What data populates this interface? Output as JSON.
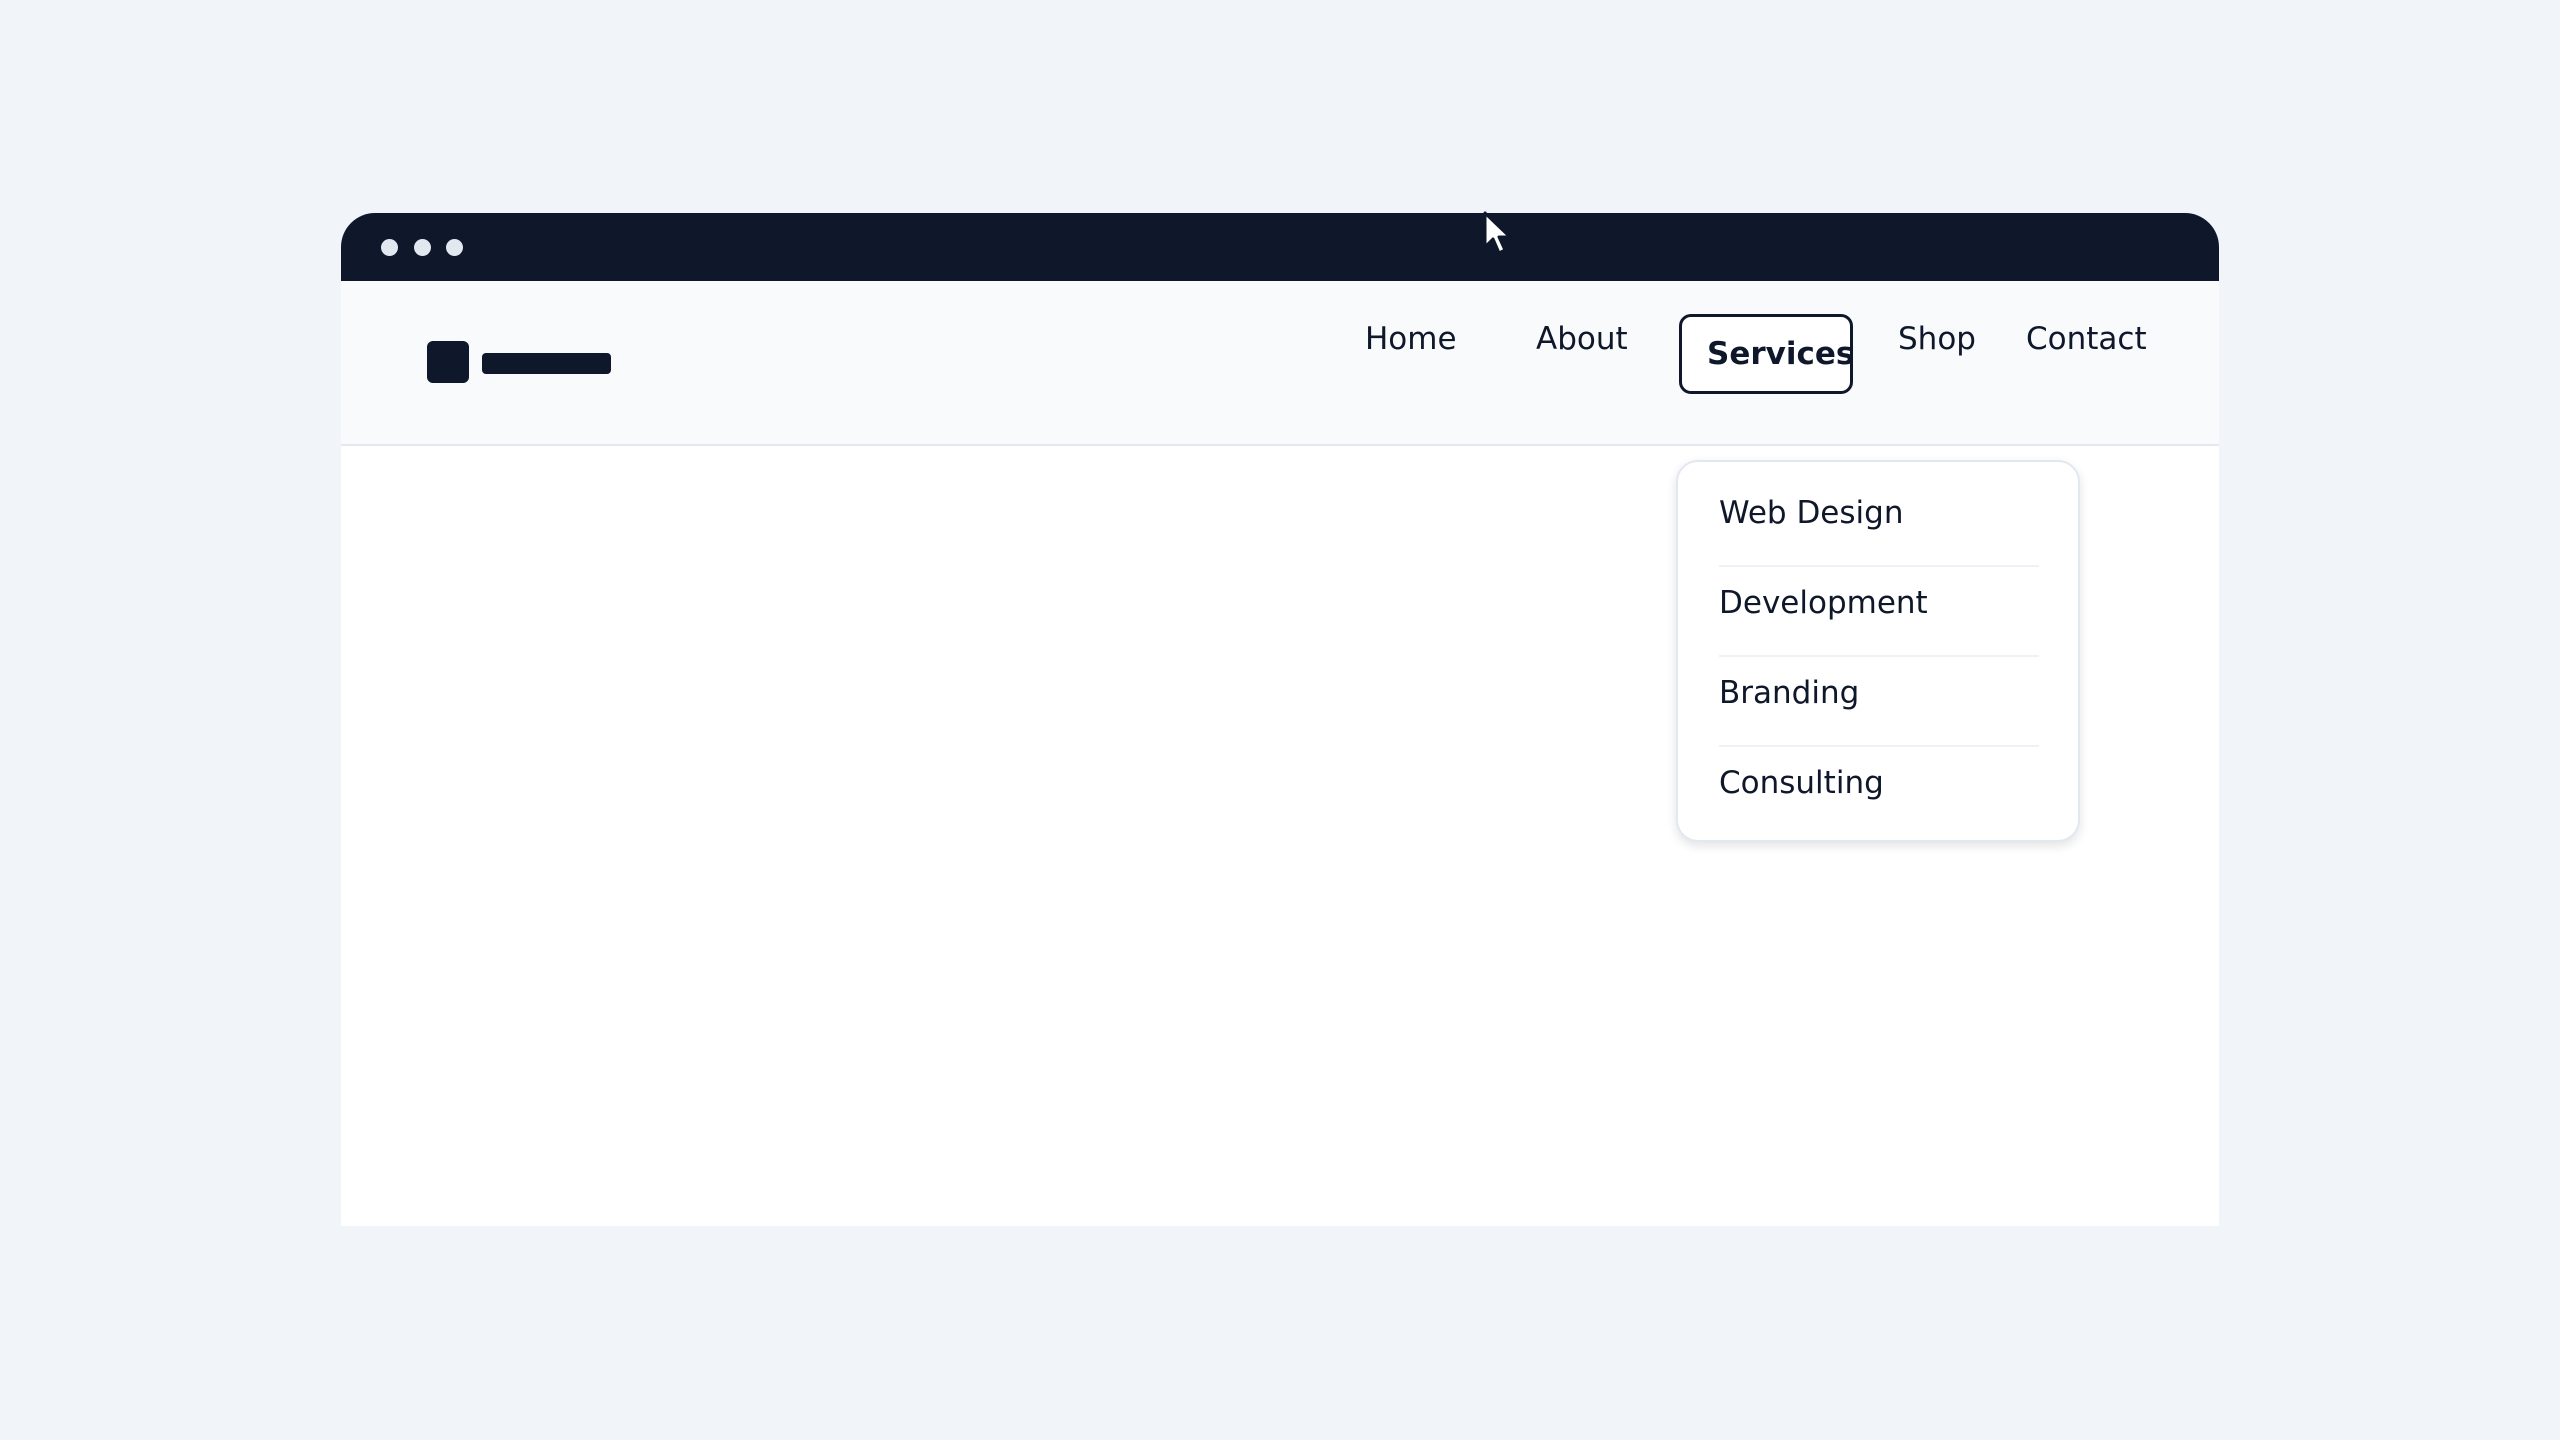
{
  "window": {
    "titlebar_color": "#0f172a",
    "traffic_lights": [
      "dot",
      "dot",
      "dot"
    ]
  },
  "header": {
    "logo": {
      "icon": "logo-mark",
      "wordmark": "logo-wordmark-placeholder"
    },
    "nav": [
      {
        "label": "Home",
        "active": false
      },
      {
        "label": "About",
        "active": false
      },
      {
        "label": "Services",
        "active": true
      },
      {
        "label": "Shop",
        "active": false
      },
      {
        "label": "Contact",
        "active": false
      }
    ]
  },
  "services_menu": {
    "open": true,
    "items": [
      {
        "label": "Web Design"
      },
      {
        "label": "Development"
      },
      {
        "label": "Branding"
      },
      {
        "label": "Consulting"
      }
    ]
  },
  "cursor": {
    "icon": "mouse-pointer-icon"
  },
  "colors": {
    "page_background": "#f1f4f9",
    "text": "#0f172a",
    "divider": "#e2e8f0"
  }
}
